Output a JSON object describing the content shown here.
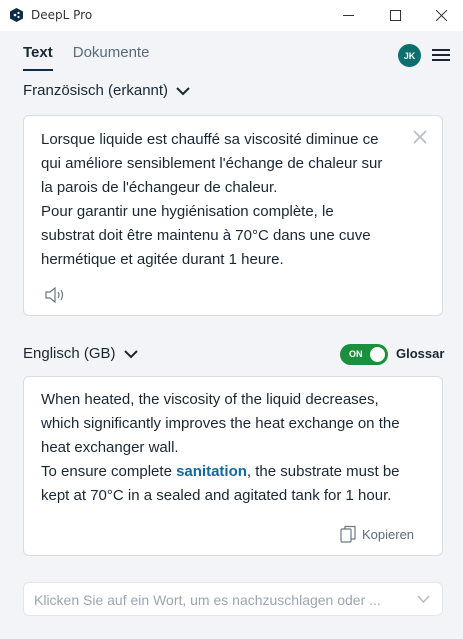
{
  "window": {
    "title": "DeepL Pro"
  },
  "tabs": [
    {
      "label": "Text",
      "active": true
    },
    {
      "label": "Dokumente",
      "active": false
    }
  ],
  "user": {
    "initials": "JK"
  },
  "source": {
    "language": "Französisch (erkannt)",
    "text": "Lorsque liquide est chauffé sa viscosité diminue ce\nqui améliore sensiblement l'échange de chaleur sur\nla parois de l'échangeur de chaleur.\nPour garantir une hygiénisation complète, le\nsubstrat doit être maintenu à 70°C dans une cuve\nhermétique et agitée durant 1 heure."
  },
  "target": {
    "language": "Englisch (GB)",
    "text_before": "When heated, the viscosity of the liquid decreases,\nwhich significantly improves the heat exchange on the\nheat exchanger wall.\nTo ensure complete ",
    "highlight": "sanitation",
    "text_after": ", the substrate must be\nkept at 70°C in a sealed and agitated tank for 1 hour.",
    "copy_label": "Kopieren"
  },
  "glossary": {
    "toggle_label": "ON",
    "label": "Glossar",
    "enabled": true
  },
  "dictionary": {
    "placeholder": "Klicken Sie auf ein Wort, um es nachzuschlagen oder ..."
  },
  "colors": {
    "accent": "#0f2b46",
    "toggle_on": "#1a8f3c",
    "avatar": "#0d6e6e",
    "highlight": "#0f6aa0"
  }
}
